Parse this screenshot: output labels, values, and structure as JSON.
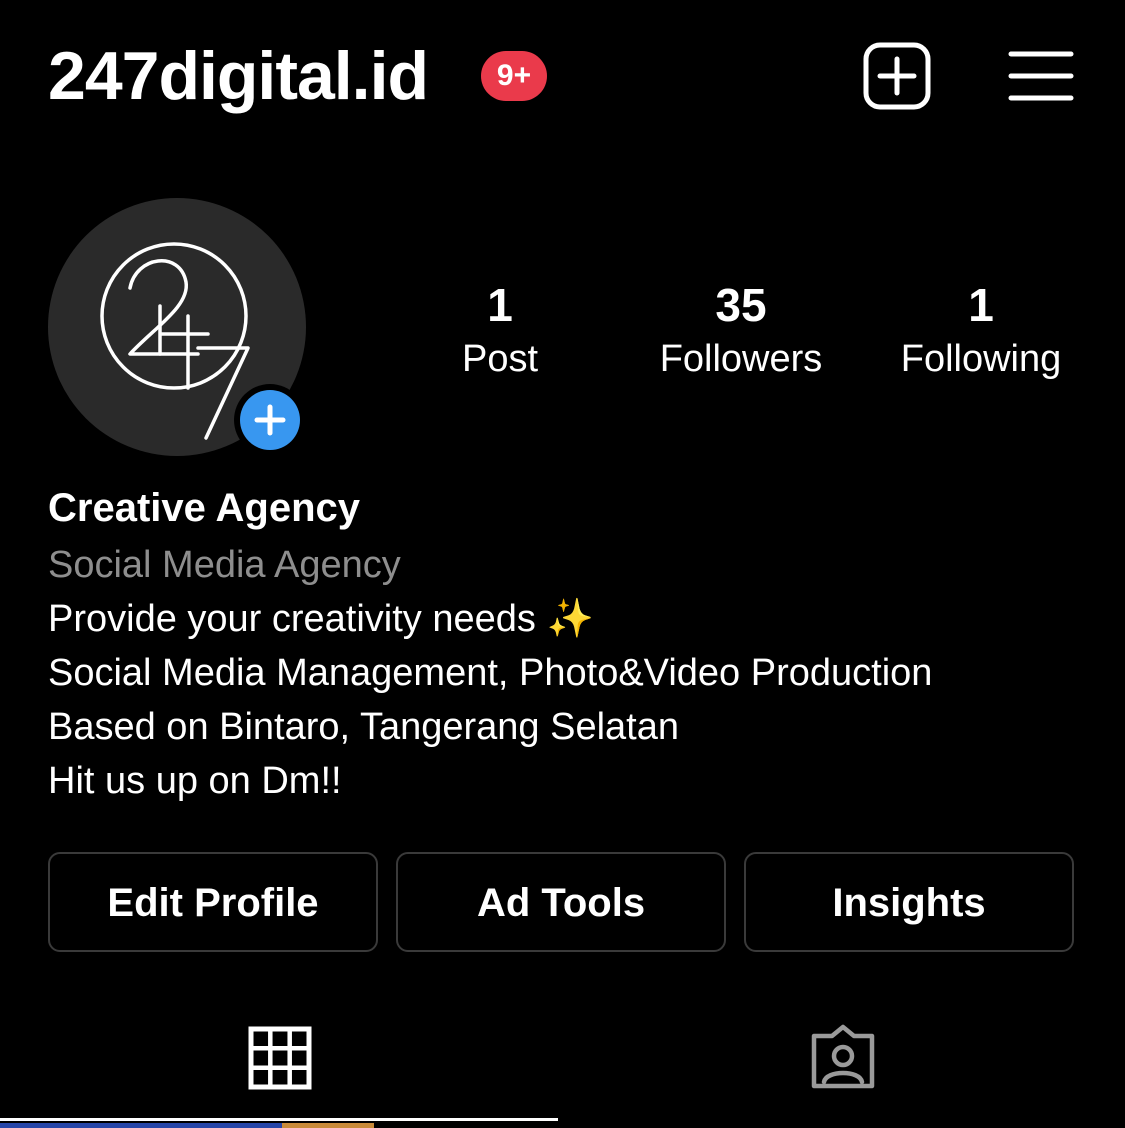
{
  "header": {
    "username": "247digital.id",
    "notification_badge": "9+",
    "new_post_icon": "plus-square-icon",
    "menu_icon": "hamburger-menu-icon"
  },
  "profile": {
    "avatar_text": "247",
    "avatar_add_icon": "plus-circle-icon",
    "stats": [
      {
        "value": "1",
        "label": "Post"
      },
      {
        "value": "35",
        "label": "Followers"
      },
      {
        "value": "1",
        "label": "Following"
      }
    ]
  },
  "bio": {
    "name": "Creative Agency",
    "category": "Social Media Agency",
    "lines": [
      "Provide your creativity needs ✨",
      "Social Media Management, Photo&Video Production",
      "Based on Bintaro, Tangerang Selatan",
      "Hit us up on Dm!!"
    ]
  },
  "actions": {
    "edit_profile": "Edit Profile",
    "ad_tools": "Ad Tools",
    "insights": "Insights"
  },
  "tabs": {
    "grid_icon": "grid-icon",
    "tagged_icon": "tagged-person-icon",
    "active": "grid"
  },
  "colors": {
    "background": "#000000",
    "badge": "#ea3a4b",
    "accent_blue": "#3897f0",
    "secondary_text": "#8e8e8e",
    "button_border": "#3a3a3a"
  }
}
